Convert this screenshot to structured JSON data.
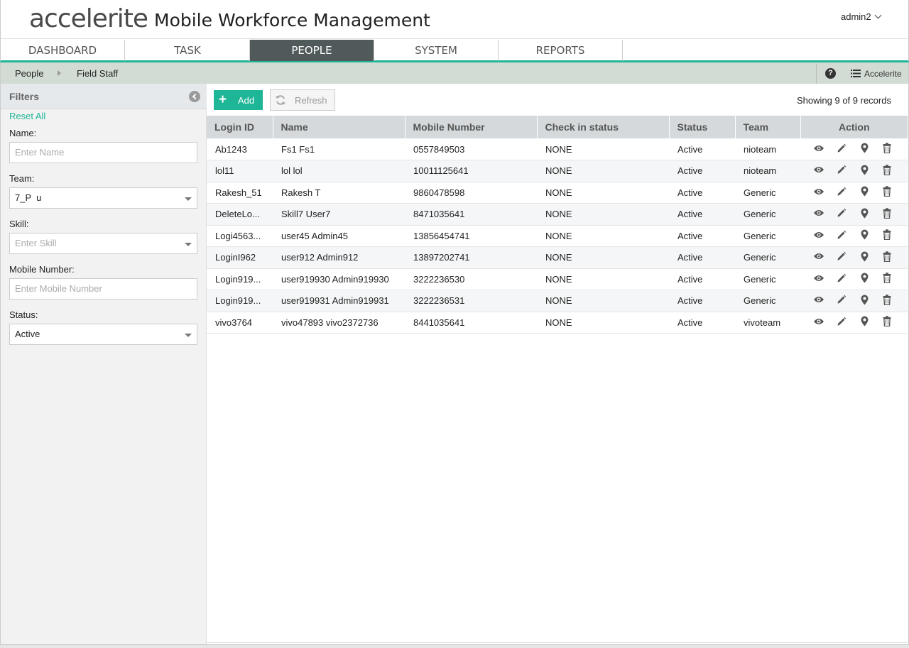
{
  "header": {
    "logo_text": "accelerite",
    "app_title": "Mobile Workforce Management",
    "user": "admin2"
  },
  "nav": {
    "tabs": [
      {
        "label": "DASHBOARD"
      },
      {
        "label": "TASK"
      },
      {
        "label": "PEOPLE"
      },
      {
        "label": "SYSTEM"
      },
      {
        "label": "REPORTS"
      }
    ],
    "active": "PEOPLE"
  },
  "breadcrumb": {
    "items": [
      "People",
      "Field Staff"
    ],
    "help_icon": "question-circle-icon",
    "tenant": "Accelerite"
  },
  "filters": {
    "title": "Filters",
    "reset_all": "Reset All",
    "name_label": "Name:",
    "name_placeholder": "Enter Name",
    "team_label": "Team:",
    "team_value": "7_P  u",
    "skill_label": "Skill:",
    "skill_placeholder": "Enter Skill",
    "mobile_label": "Mobile Number:",
    "mobile_placeholder": "Enter Mobile Number",
    "status_label": "Status:",
    "status_value": "Active"
  },
  "toolbar": {
    "add_label": "Add",
    "refresh_label": "Refresh",
    "records_text": "Showing 9 of 9 records"
  },
  "table": {
    "columns": [
      "Login ID",
      "Name",
      "Mobile Number",
      "Check in status",
      "Status",
      "Team",
      "Action"
    ],
    "rows": [
      {
        "login": "Ab1243",
        "name": "Fs1 Fs1",
        "mobile": "0557849503",
        "checkin": "NONE",
        "status": "Active",
        "team": "nioteam"
      },
      {
        "login": "lol11",
        "name": "lol lol",
        "mobile": "10011125641",
        "checkin": "NONE",
        "status": "Active",
        "team": "nioteam"
      },
      {
        "login": "Rakesh_51",
        "name": "Rakesh T",
        "mobile": "9860478598",
        "checkin": "NONE",
        "status": "Active",
        "team": "Generic"
      },
      {
        "login": "DeleteLo...",
        "name": "Skill7 User7",
        "mobile": "8471035641",
        "checkin": "NONE",
        "status": "Active",
        "team": "Generic"
      },
      {
        "login": "Logi4563...",
        "name": "user45 Admin45",
        "mobile": "13856454741",
        "checkin": "NONE",
        "status": "Active",
        "team": "Generic"
      },
      {
        "login": "LoginI962",
        "name": "user912 Admin912",
        "mobile": "13897202741",
        "checkin": "NONE",
        "status": "Active",
        "team": "Generic"
      },
      {
        "login": "Login919...",
        "name": "user919930 Admin919930",
        "mobile": "3222236530",
        "checkin": "NONE",
        "status": "Active",
        "team": "Generic"
      },
      {
        "login": "Login919...",
        "name": "user919931 Admin919931",
        "mobile": "3222236531",
        "checkin": "NONE",
        "status": "Active",
        "team": "Generic"
      },
      {
        "login": "vivo3764",
        "name": "vivo47893 vivo2372736",
        "mobile": "8441035641",
        "checkin": "NONE",
        "status": "Active",
        "team": "vivoteam"
      }
    ],
    "action_icons": [
      "eye-icon",
      "pencil-icon",
      "map-pin-icon",
      "trash-icon"
    ]
  },
  "colors": {
    "accent": "#1fb597",
    "nav_active": "#515a5a",
    "breadcrumb_bg": "#d3dcd4"
  }
}
